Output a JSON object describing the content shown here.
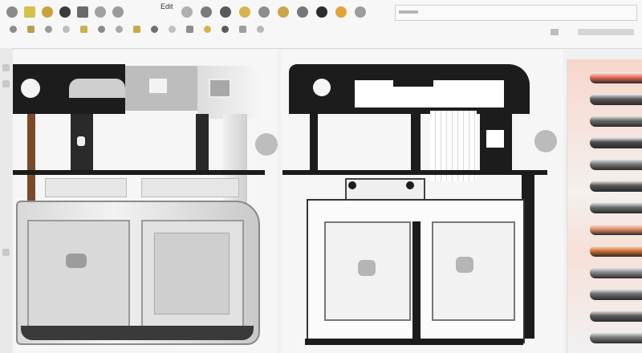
{
  "app": {
    "menu_label": "Edit"
  },
  "toolbar": {
    "row1_icons": [
      {
        "name": "circle-tool-icon",
        "color": "#8a8a8a"
      },
      {
        "name": "material-icon",
        "color": "#d4c04a"
      },
      {
        "name": "paint-icon",
        "color": "#c9a23a"
      },
      {
        "name": "sphere-icon",
        "color": "#3a3a3a"
      },
      {
        "name": "select-icon",
        "color": "#6a6a6a"
      },
      {
        "name": "move-icon",
        "color": "#a0a0a0"
      },
      {
        "name": "rotate-icon",
        "color": "#9a9a9a"
      },
      {
        "name": "scale-icon",
        "color": "#b0b0b0"
      },
      {
        "name": "snap-icon",
        "color": "#7c7c7c"
      },
      {
        "name": "render-icon",
        "color": "#5a5a5a"
      },
      {
        "name": "light-icon",
        "color": "#d6b44e"
      },
      {
        "name": "camera-icon",
        "color": "#8e8e8e"
      },
      {
        "name": "texture-icon",
        "color": "#caa54a"
      },
      {
        "name": "settings-icon",
        "color": "#777777"
      },
      {
        "name": "globe-icon",
        "color": "#2d2d2d"
      },
      {
        "name": "color-icon",
        "color": "#e0a43a"
      },
      {
        "name": "layer-icon",
        "color": "#9c9c9c"
      }
    ],
    "row2_icons": [
      {
        "name": "orbit-icon",
        "color": "#8c8c8c"
      },
      {
        "name": "pan-icon",
        "color": "#b5a050"
      },
      {
        "name": "zoom-icon",
        "color": "#9a9a9a"
      },
      {
        "name": "grid-icon",
        "color": "#bdbdbd"
      },
      {
        "name": "wire-icon",
        "color": "#c8b04c"
      },
      {
        "name": "shade-icon",
        "color": "#8a8a8a"
      },
      {
        "name": "xray-icon",
        "color": "#aaaaaa"
      },
      {
        "name": "measure-icon",
        "color": "#cba848"
      },
      {
        "name": "align-icon",
        "color": "#6f6f6f"
      },
      {
        "name": "group-icon",
        "color": "#c0c0c0"
      },
      {
        "name": "ungroup-icon",
        "color": "#8e8e8e"
      },
      {
        "name": "lock-icon",
        "color": "#d2b24a"
      },
      {
        "name": "eye-icon",
        "color": "#5c5c5c"
      },
      {
        "name": "hide-icon",
        "color": "#9e9e9e"
      },
      {
        "name": "export-icon",
        "color": "#b8b8b8"
      }
    ]
  },
  "swatches": [
    {
      "name": "swatch-coral",
      "color": "#e86a52"
    },
    {
      "name": "swatch-graphite-1",
      "color": "#5a5a5a"
    },
    {
      "name": "swatch-graphite-2",
      "color": "#6b6b6b"
    },
    {
      "name": "swatch-graphite-3",
      "color": "#4a4a4a"
    },
    {
      "name": "swatch-graphite-4",
      "color": "#7a7a7a"
    },
    {
      "name": "swatch-graphite-5",
      "color": "#555555"
    },
    {
      "name": "swatch-graphite-6",
      "color": "#6f6f6f"
    },
    {
      "name": "swatch-peach",
      "color": "#e8926e"
    },
    {
      "name": "swatch-orange",
      "color": "#d9762e"
    },
    {
      "name": "swatch-silver-1",
      "color": "#8a8a8a"
    },
    {
      "name": "swatch-silver-2",
      "color": "#6e6e6e"
    },
    {
      "name": "swatch-silver-3",
      "color": "#5e5e5e"
    },
    {
      "name": "swatch-silver-4",
      "color": "#7d7d7d"
    }
  ]
}
